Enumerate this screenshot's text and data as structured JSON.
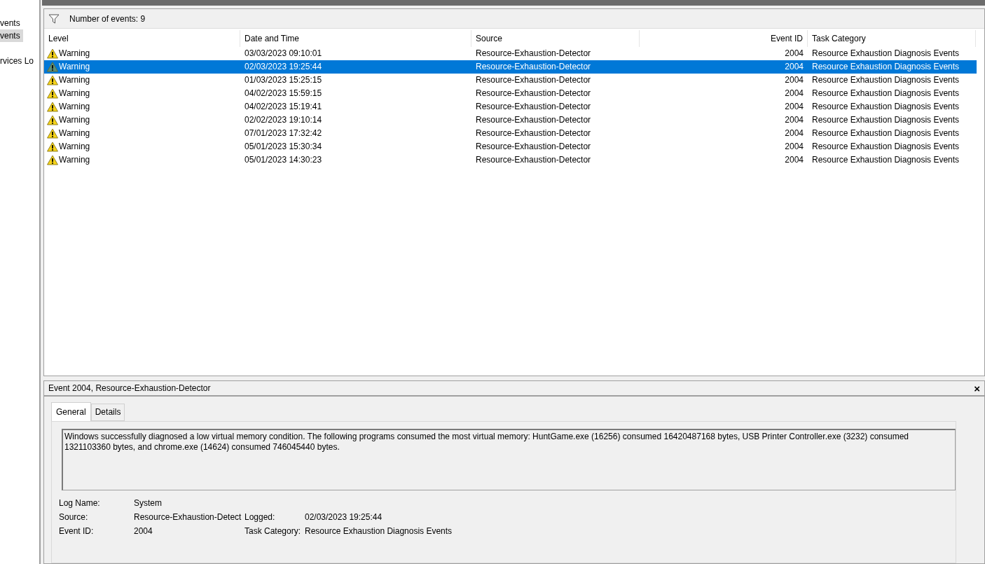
{
  "sidebar": {
    "items": [
      {
        "label": "vents",
        "selected": false
      },
      {
        "label": "vents",
        "selected": true
      },
      {
        "label": "rvices Lo",
        "selected": false
      }
    ]
  },
  "events_panel": {
    "count_label": "Number of events: 9"
  },
  "table": {
    "columns": [
      "Level",
      "Date and Time",
      "Source",
      "Event ID",
      "Task Category"
    ],
    "rows": [
      {
        "level": "Warning",
        "date": "03/03/2023 09:10:01",
        "source": "Resource-Exhaustion-Detector",
        "event_id": "2004",
        "category": "Resource Exhaustion Diagnosis Events",
        "selected": false
      },
      {
        "level": "Warning",
        "date": "02/03/2023 19:25:44",
        "source": "Resource-Exhaustion-Detector",
        "event_id": "2004",
        "category": "Resource Exhaustion Diagnosis Events",
        "selected": true
      },
      {
        "level": "Warning",
        "date": "01/03/2023 15:25:15",
        "source": "Resource-Exhaustion-Detector",
        "event_id": "2004",
        "category": "Resource Exhaustion Diagnosis Events",
        "selected": false
      },
      {
        "level": "Warning",
        "date": "04/02/2023 15:59:15",
        "source": "Resource-Exhaustion-Detector",
        "event_id": "2004",
        "category": "Resource Exhaustion Diagnosis Events",
        "selected": false
      },
      {
        "level": "Warning",
        "date": "04/02/2023 15:19:41",
        "source": "Resource-Exhaustion-Detector",
        "event_id": "2004",
        "category": "Resource Exhaustion Diagnosis Events",
        "selected": false
      },
      {
        "level": "Warning",
        "date": "02/02/2023 19:10:14",
        "source": "Resource-Exhaustion-Detector",
        "event_id": "2004",
        "category": "Resource Exhaustion Diagnosis Events",
        "selected": false
      },
      {
        "level": "Warning",
        "date": "07/01/2023 17:32:42",
        "source": "Resource-Exhaustion-Detector",
        "event_id": "2004",
        "category": "Resource Exhaustion Diagnosis Events",
        "selected": false
      },
      {
        "level": "Warning",
        "date": "05/01/2023 15:30:34",
        "source": "Resource-Exhaustion-Detector",
        "event_id": "2004",
        "category": "Resource Exhaustion Diagnosis Events",
        "selected": false
      },
      {
        "level": "Warning",
        "date": "05/01/2023 14:30:23",
        "source": "Resource-Exhaustion-Detector",
        "event_id": "2004",
        "category": "Resource Exhaustion Diagnosis Events",
        "selected": false
      }
    ]
  },
  "detail": {
    "title": "Event 2004, Resource-Exhaustion-Detector",
    "close": "×",
    "tabs": [
      {
        "label": "General",
        "selected": true
      },
      {
        "label": "Details",
        "selected": false
      }
    ],
    "message": "Windows successfully diagnosed a low virtual memory condition. The following programs consumed the most virtual memory: HuntGame.exe (16256) consumed 16420487168 bytes, USB Printer Controller.exe (3232) consumed 1321103360 bytes, and chrome.exe (14624) consumed 746045440 bytes.",
    "fields": [
      [
        {
          "label": "Log Name:",
          "value": "System"
        }
      ],
      [
        {
          "label": "Source:",
          "value": "Resource-Exhaustion-Detect"
        },
        {
          "label": "Logged:",
          "value": "02/03/2023 19:25:44"
        }
      ],
      [
        {
          "label": "Event ID:",
          "value": "2004"
        },
        {
          "label": "Task Category:",
          "value": "Resource Exhaustion Diagnosis Events"
        }
      ]
    ]
  }
}
